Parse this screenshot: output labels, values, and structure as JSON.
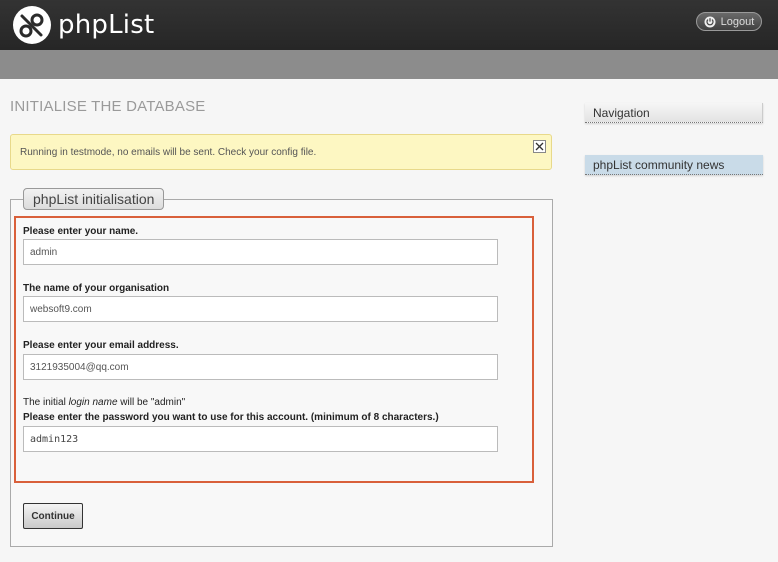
{
  "header": {
    "brand": "phpList",
    "logout_label": "Logout",
    "logo_icon": "phplist-logo-icon",
    "logout_icon": "power-icon"
  },
  "main": {
    "title": "INITIALISE THE DATABASE",
    "notice": {
      "text": "Running in testmode, no emails will be sent. Check your config file.",
      "close_icon": "close-icon"
    },
    "form": {
      "legend": "phpList initialisation",
      "name_label": "Please enter your name.",
      "name_value": "admin",
      "org_label": "The name of your organisation",
      "org_value": "websoft9.com",
      "email_label": "Please enter your email address.",
      "email_value": "3121935004@qq.com",
      "login_prefix": "The initial ",
      "login_em": "login name",
      "login_suffix": " will be \"admin\"",
      "password_label": "Please enter the password you want to use for this account. (minimum of 8 characters.)",
      "password_value": "admin123",
      "continue_label": "Continue"
    }
  },
  "sidebar": {
    "navigation_label": "Navigation",
    "news_label": "phpList community news"
  },
  "colors": {
    "topbar": "#2b2b2b",
    "subbar": "#8c8c8c",
    "notice_bg": "#fdf7c2",
    "highlight_border": "#d9603b",
    "news_bg": "#c9dbe8"
  }
}
